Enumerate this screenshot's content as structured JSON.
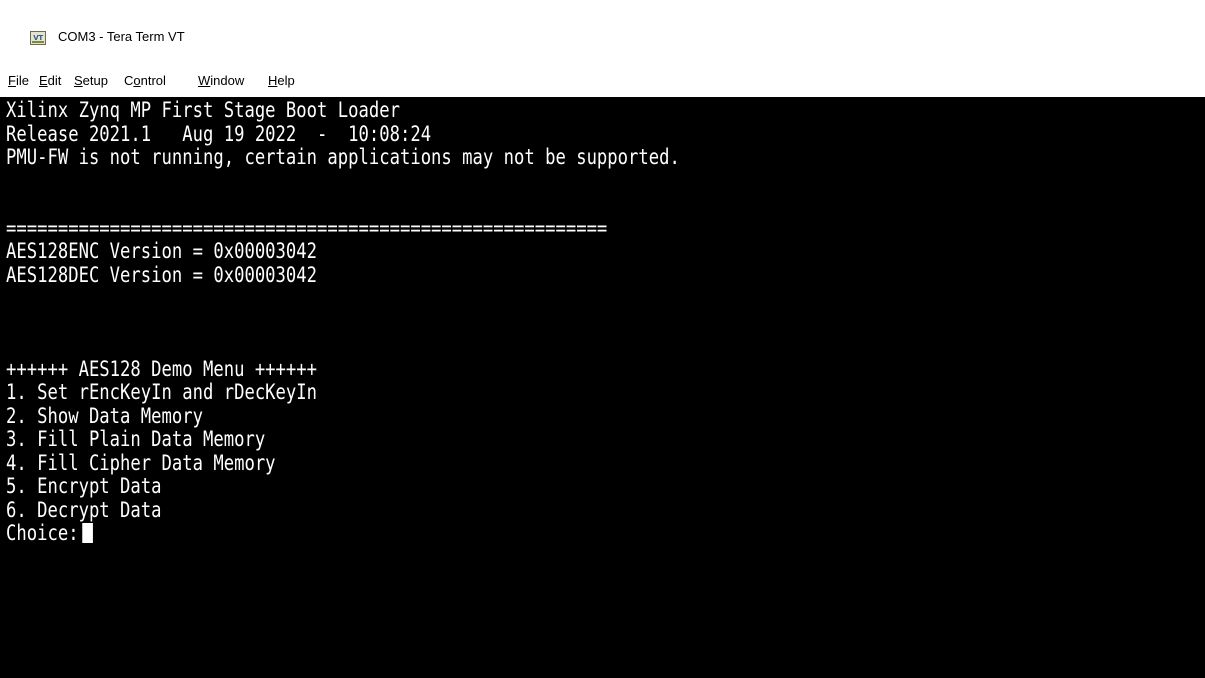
{
  "window": {
    "title": "COM3 - Tera Term VT",
    "icon": "VT"
  },
  "menu": {
    "items": [
      {
        "acc": "F",
        "rest": "ile"
      },
      {
        "acc": "E",
        "rest": "dit"
      },
      {
        "acc": "S",
        "rest": "etup"
      },
      {
        "pre": "C",
        "acc": "o",
        "rest": "ntrol"
      },
      {
        "acc": "W",
        "rest": "indow"
      },
      {
        "acc": "H",
        "rest": "elp"
      }
    ]
  },
  "terminal": {
    "lines": [
      "Xilinx Zynq MP First Stage Boot Loader",
      "Release 2021.1   Aug 19 2022  -  10:08:24",
      "PMU-FW is not running, certain applications may not be supported.",
      "",
      "",
      "==========================================================",
      "AES128ENC Version = 0x00003042",
      "AES128DEC Version = 0x00003042",
      "",
      "",
      "",
      "++++++ AES128 Demo Menu ++++++",
      "1. Set rEncKeyIn and rDecKeyIn",
      "2. Show Data Memory",
      "3. Fill Plain Data Memory",
      "4. Fill Cipher Data Memory",
      "5. Encrypt Data",
      "6. Decrypt Data"
    ],
    "prompt": "Choice:"
  }
}
